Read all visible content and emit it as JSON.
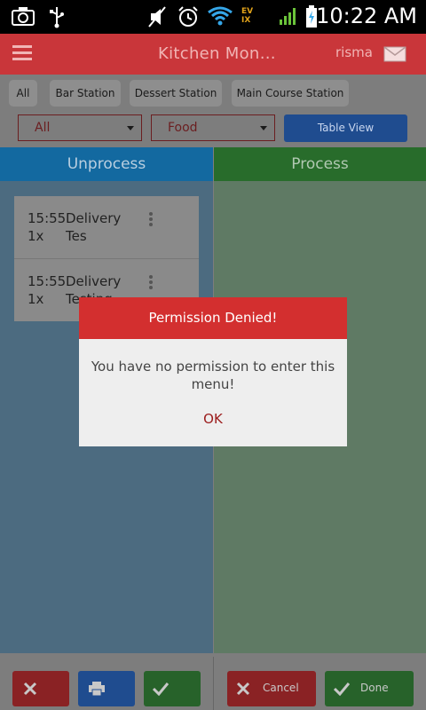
{
  "status_bar": {
    "time": "10:22 AM",
    "network_label": "EV\nIX",
    "icons": [
      "camera-icon",
      "usb-icon",
      "mute-icon",
      "alarm-icon",
      "wifi-icon",
      "signal-icon",
      "battery-icon"
    ]
  },
  "app_bar": {
    "title": "Kitchen Mon…",
    "user": "risma",
    "icons": [
      "menu-icon",
      "mail-icon"
    ]
  },
  "filters": {
    "stations": [
      "All",
      "Bar Station",
      "Dessert Station",
      "Main Course Station"
    ],
    "select_1": "All",
    "select_2": "Food",
    "table_view_label": "Table View"
  },
  "columns": {
    "unprocess_label": "Unprocess",
    "process_label": "Process"
  },
  "orders": [
    {
      "time": "15:55",
      "type": "Delivery",
      "qty": "1x",
      "name": "Tes"
    },
    {
      "time": "15:55",
      "type": "Delivery",
      "qty": "1x",
      "name": "Testing"
    }
  ],
  "bottom_bar": {
    "cancel_label": "Cancel",
    "done_label": "Done"
  },
  "dialog": {
    "title": "Permission Denied!",
    "message": "You have no permission to enter this menu!",
    "ok_label": "OK"
  },
  "colors": {
    "app_bar": "#c9363a",
    "dialog_header": "#d32f2f",
    "unprocess_header": "#1369a0",
    "process_header": "#286c2b",
    "table_view_button": "#1f4c8f"
  }
}
